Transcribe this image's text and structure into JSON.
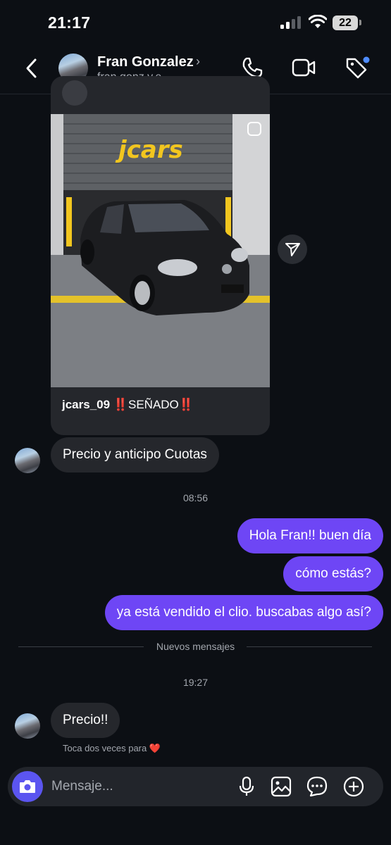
{
  "status_bar": {
    "time": "21:17",
    "battery": "22"
  },
  "header": {
    "name": "Fran Gonzalez",
    "handle": "fran.gonz.v.e",
    "chevron": "›",
    "icons": [
      "back-arrow-icon",
      "phone-icon",
      "video-icon",
      "tag-icon"
    ],
    "tag_badge_color": "#4f8cff"
  },
  "shared_post": {
    "storefront_logo": "jcars",
    "caption_user": "jcars_09",
    "caption_mark": "‼️",
    "caption_text": "SEÑADO",
    "caption_mark_end": "‼️"
  },
  "messages": [
    {
      "from": "them",
      "text": "Precio y anticipo Cuotas"
    },
    {
      "type": "timestamp",
      "text": "08:56"
    },
    {
      "from": "me",
      "text": "Hola Fran!! buen día"
    },
    {
      "from": "me",
      "text": "cómo estás?"
    },
    {
      "from": "me",
      "text": "ya está vendido el clio. buscabas algo así?"
    },
    {
      "type": "divider",
      "text": "Nuevos mensajes"
    },
    {
      "type": "timestamp",
      "text": "19:27"
    },
    {
      "from": "them",
      "text": "Precio!!"
    }
  ],
  "hint": {
    "text": "Toca dos veces para",
    "emoji": "❤️"
  },
  "composer": {
    "placeholder": "Mensaje...",
    "icons": [
      "camera-icon",
      "microphone-icon",
      "gallery-icon",
      "sticker-icon",
      "plus-icon"
    ]
  },
  "colors": {
    "outgoing_bubble": "#6e46f5",
    "incoming_bubble": "#25272c",
    "background": "#0c0f14",
    "camera_button": "#5b55f0"
  }
}
